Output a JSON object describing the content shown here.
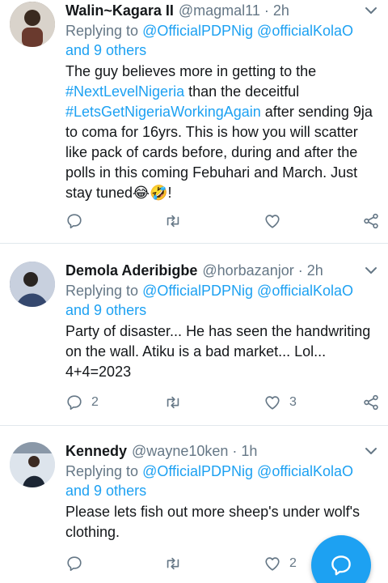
{
  "tweets": [
    {
      "name": "Walin~Kagara II",
      "handle": "@magmal11",
      "time": "2h",
      "reply_prefix": "Replying to ",
      "reply_mentions": "@OfficialPDPNig @officialKolaO",
      "reply_and": " and 9 others",
      "body_parts": [
        {
          "text": "The guy believes more in getting to the ",
          "tag": false
        },
        {
          "text": "#NextLevelNigeria",
          "tag": true
        },
        {
          "text": " than the deceitful ",
          "tag": false
        },
        {
          "text": "#LetsGetNigeriaWorkingAgain",
          "tag": true
        },
        {
          "text": " after sending 9ja to coma for 16yrs. This is how you will scatter like pack of cards before, during and after the polls in this coming Febuhari and March. Just stay tuned😂🤣!",
          "tag": false
        }
      ],
      "reply_count": "",
      "like_count": ""
    },
    {
      "name": "Demola Aderibigbe",
      "handle": "@horbazanjor",
      "time": "2h",
      "reply_prefix": "Replying to ",
      "reply_mentions": "@OfficialPDPNig @officialKolaO",
      "reply_and": " and 9 others",
      "body_parts": [
        {
          "text": "Party of disaster... He has seen the handwriting on the wall. Atiku is a bad market... Lol... 4+4=2023",
          "tag": false
        }
      ],
      "reply_count": "2",
      "like_count": "3"
    },
    {
      "name": "Kennedy",
      "handle": "@wayne10ken",
      "time": "1h",
      "reply_prefix": "Replying to ",
      "reply_mentions": "@OfficialPDPNig @officialKolaO",
      "reply_and": " and 9 others",
      "body_parts": [
        {
          "text": "Please lets fish out more sheep's under wolf's clothing.",
          "tag": false
        }
      ],
      "reply_count": "",
      "like_count": "2"
    }
  ],
  "separator": "·",
  "icons": {
    "reply": "reply-icon",
    "retweet": "retweet-icon",
    "like": "heart-icon",
    "share": "share-icon",
    "menu": "chevron-down-icon",
    "compose": "compose-reply-icon"
  },
  "colors": {
    "accent": "#1da1f2",
    "secondary_text": "#657786",
    "primary_text": "#14171a",
    "divider": "#e1e8ed"
  }
}
